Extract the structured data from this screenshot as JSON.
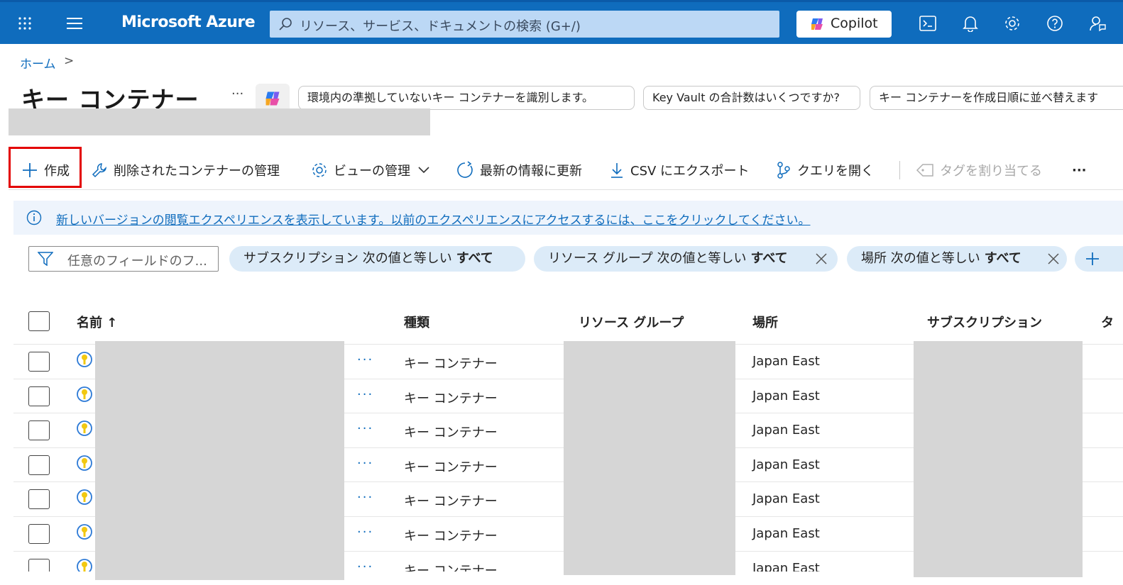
{
  "topbar": {
    "brand": "Microsoft Azure",
    "search_placeholder": "リソース、サービス、ドキュメントの検索 (G+/)",
    "copilot_label": "Copilot"
  },
  "breadcrumb": {
    "home": "ホーム",
    "separator": ">"
  },
  "page": {
    "title": "キー コンテナー",
    "more": "···",
    "suggestions": [
      "環境内の準拠していないキー コンテナーを識別します。",
      "Key Vault の合計数はいくつですか?",
      "キー コンテナーを作成日順に並べ替えます"
    ]
  },
  "toolbar": {
    "create": "作成",
    "manage_deleted": "削除されたコンテナーの管理",
    "manage_view": "ビューの管理",
    "refresh": "最新の情報に更新",
    "export_csv": "CSV にエクスポート",
    "open_query": "クエリを開く",
    "assign_tags": "タグを割り当てる",
    "more": "···"
  },
  "info_banner": "新しいバージョンの閲覧エクスペリエンスを表示しています。以前のエクスペリエンスにアクセスするには、ここをクリックしてください。",
  "filters": {
    "search_placeholder": "任意のフィールドのフ...",
    "pills": [
      {
        "label": "サブスクリプション 次の値と等しい",
        "value": "すべて"
      },
      {
        "label": "リソース グループ 次の値と等しい",
        "value": "すべて"
      },
      {
        "label": "場所 次の値と等しい",
        "value": "すべて"
      }
    ],
    "add": "+"
  },
  "table": {
    "columns": [
      "名前 ↑",
      "種類",
      "リソース グループ",
      "場所",
      "サブスクリプション",
      "タ"
    ],
    "rows": [
      {
        "type": "キー コンテナー",
        "location": "Japan East",
        "actions": "···"
      },
      {
        "type": "キー コンテナー",
        "location": "Japan East",
        "actions": "···"
      },
      {
        "type": "キー コンテナー",
        "location": "Japan East",
        "actions": "···"
      },
      {
        "type": "キー コンテナー",
        "location": "Japan East",
        "actions": "···"
      },
      {
        "type": "キー コンテナー",
        "location": "Japan East",
        "actions": "···"
      },
      {
        "type": "キー コンテナー",
        "location": "Japan East",
        "actions": "···"
      },
      {
        "type": "キー コンテナー",
        "location": "Japan East",
        "actions": "···"
      }
    ]
  },
  "colors": {
    "azure_blue": "#0f6cbd",
    "highlight_red": "#e30000",
    "pill_bg": "#dcebf8"
  }
}
